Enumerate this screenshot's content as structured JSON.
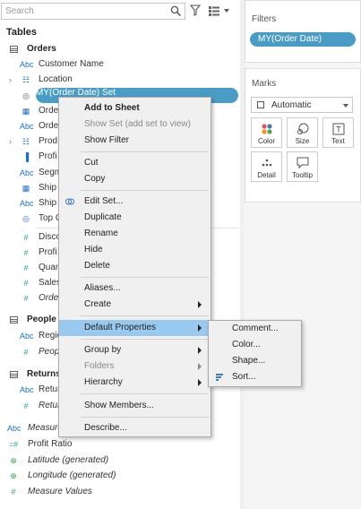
{
  "data_pane": {
    "search_placeholder": "Search",
    "tables_title": "Tables",
    "orders": {
      "label": "Orders",
      "fields": [
        {
          "icon": "Abc",
          "label": "Customer Name"
        },
        {
          "icon": "geo",
          "label": "Location"
        },
        {
          "icon": "set",
          "label": "MY(Order Date) Set"
        },
        {
          "icon": "date",
          "label": "Orde"
        },
        {
          "icon": "Abc",
          "label": "Orde"
        },
        {
          "icon": "hier",
          "label": "Prod"
        },
        {
          "icon": "bin",
          "label": "Profi"
        },
        {
          "icon": "Abc",
          "label": "Segm"
        },
        {
          "icon": "date",
          "label": "Ship"
        },
        {
          "icon": "Abc",
          "label": "Ship"
        },
        {
          "icon": "set",
          "label": "Top C"
        },
        {
          "icon": "#",
          "label": "Disco"
        },
        {
          "icon": "#",
          "label": "Profi"
        },
        {
          "icon": "#",
          "label": "Quan"
        },
        {
          "icon": "#",
          "label": "Sales"
        },
        {
          "icon": "#",
          "label": "Orde"
        }
      ]
    },
    "people": {
      "label": "People",
      "fields": [
        {
          "icon": "Abc",
          "label": "Regio"
        },
        {
          "icon": "#",
          "label": "Peop"
        }
      ]
    },
    "returns": {
      "label": "Returns",
      "fields": [
        {
          "icon": "Abc",
          "label": "Retur"
        },
        {
          "icon": "#",
          "label": "Retur"
        }
      ]
    },
    "loose_fields": [
      {
        "icon": "Abc",
        "label": "Measure Names"
      },
      {
        "icon": "#",
        "label": "Profit Ratio"
      },
      {
        "icon": "globe",
        "label": "Latitude (generated)"
      },
      {
        "icon": "globe",
        "label": "Longitude (generated)"
      },
      {
        "icon": "#",
        "label": "Measure Values"
      }
    ]
  },
  "filters": {
    "title": "Filters",
    "pill": "MY(Order Date)"
  },
  "marks": {
    "title": "Marks",
    "mark_type": "Automatic",
    "buttons": [
      "Color",
      "Size",
      "Text",
      "Detail",
      "Tooltip"
    ]
  },
  "context_menu": {
    "items": {
      "add_to_sheet": "Add to Sheet",
      "show_set": "Show Set (add set to view)",
      "show_filter": "Show Filter",
      "cut": "Cut",
      "copy": "Copy",
      "edit_set": "Edit Set...",
      "duplicate": "Duplicate",
      "rename": "Rename",
      "hide": "Hide",
      "delete": "Delete",
      "aliases": "Aliases...",
      "create": "Create",
      "default_properties": "Default Properties",
      "group_by": "Group by",
      "folders": "Folders",
      "hierarchy": "Hierarchy",
      "show_members": "Show Members...",
      "describe": "Describe..."
    }
  },
  "submenu": {
    "comment": "Comment...",
    "color": "Color...",
    "shape": "Shape...",
    "sort": "Sort..."
  },
  "colors": {
    "accent_pill": "#4a9cc4",
    "menu_highlight": "#99c9ef"
  }
}
